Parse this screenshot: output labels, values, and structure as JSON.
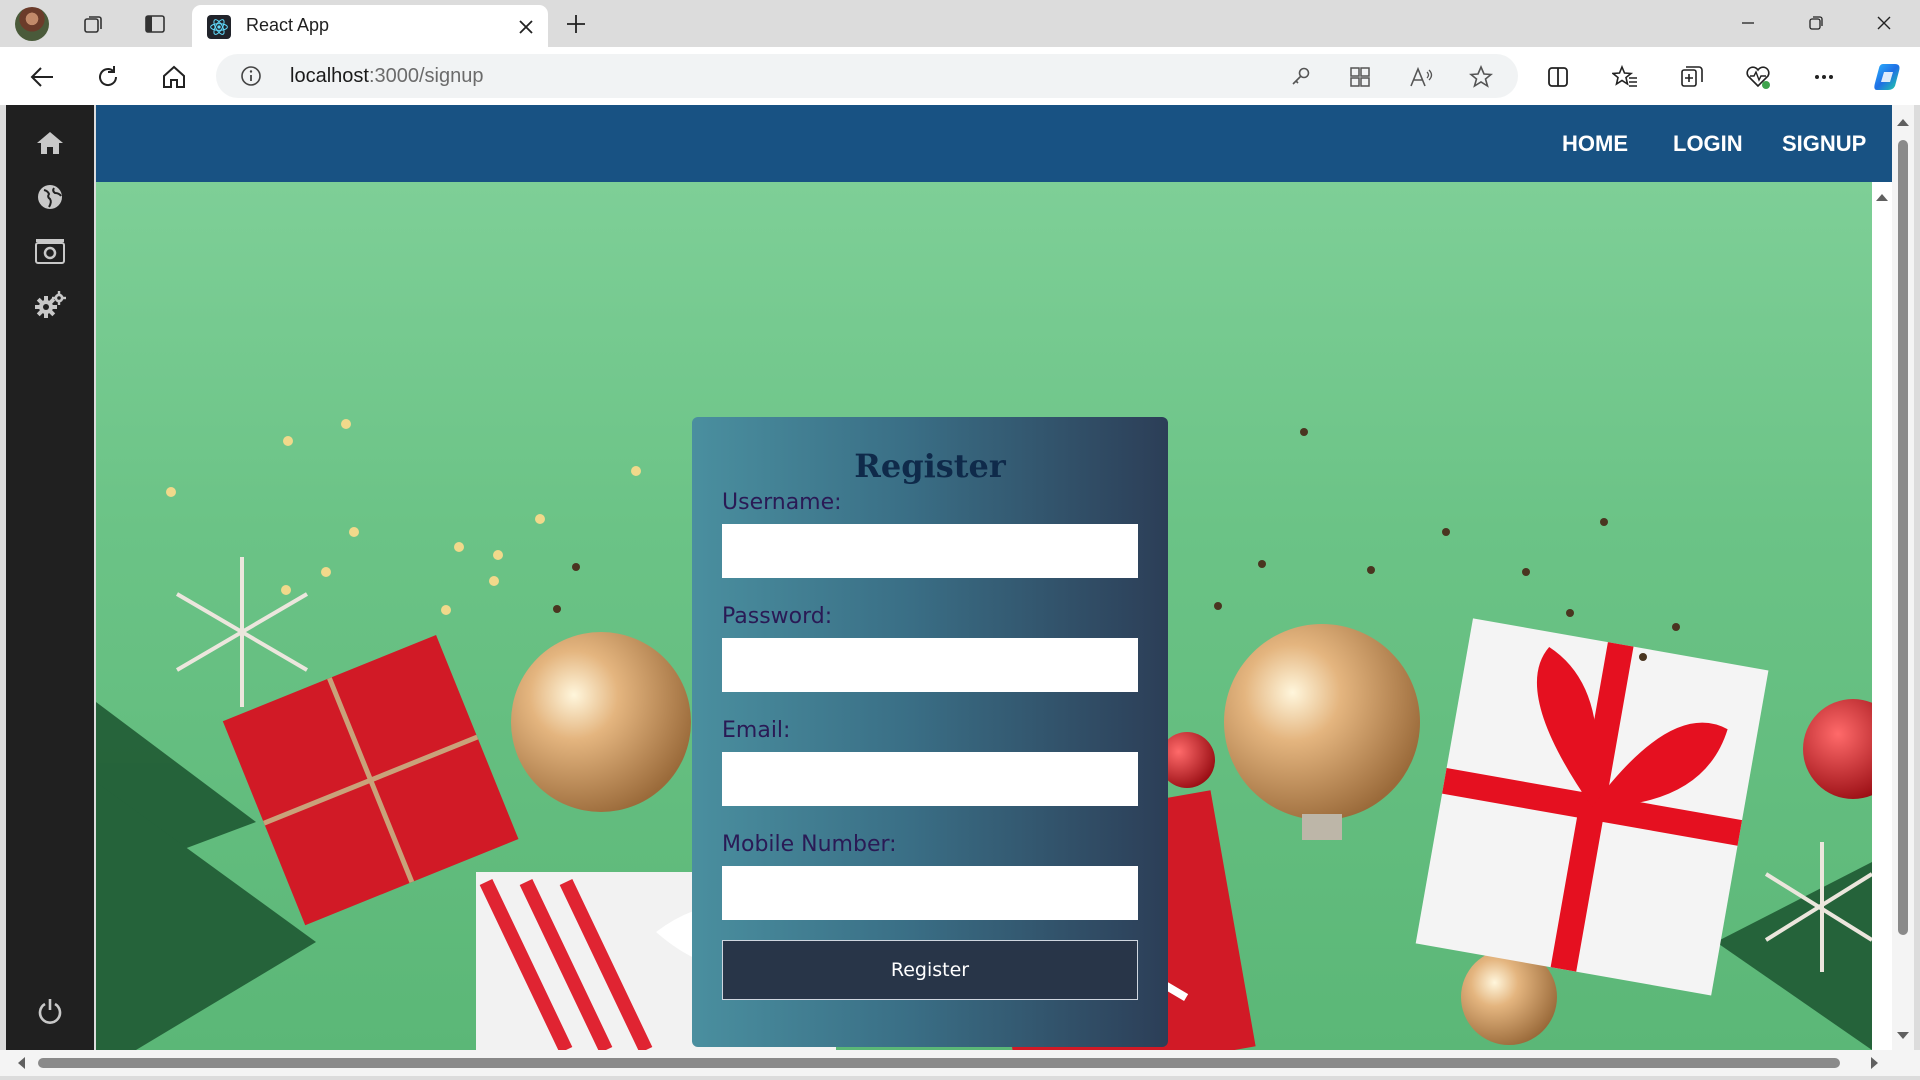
{
  "browser": {
    "tab_title": "React App",
    "url_host": "localhost",
    "url_path": ":3000/signup"
  },
  "nav": {
    "home": "HOME",
    "login": "LOGIN",
    "signup": "SIGNUP"
  },
  "form": {
    "title": "Register",
    "username_label": "Username:",
    "username_value": "",
    "password_label": "Password:",
    "password_value": "",
    "email_label": "Email:",
    "email_value": "",
    "mobile_label": "Mobile Number:",
    "mobile_value": "",
    "submit_label": "Register"
  },
  "colors": {
    "navbar": "#185283",
    "background": "#6cc489",
    "card_gradient_start": "#4a8f9f",
    "card_gradient_end": "#2c3e57",
    "title": "#0f2a4a",
    "label": "#2a1a55",
    "button": "#283548"
  },
  "icons": {
    "tab_strip": [
      "profile-avatar",
      "workspaces-icon",
      "tab-actions-icon"
    ],
    "toolbar": [
      "back-icon",
      "refresh-icon",
      "home-icon",
      "info-icon",
      "key-icon",
      "apps-icon",
      "read-aloud-icon",
      "favorite-star-icon",
      "split-screen-icon",
      "favorites-icon",
      "collections-icon",
      "browser-health-icon",
      "more-icon",
      "copilot-icon"
    ],
    "app_sidebar": [
      "home-icon",
      "globe-icon",
      "camera-icon",
      "settings-gears-icon",
      "power-icon"
    ]
  }
}
